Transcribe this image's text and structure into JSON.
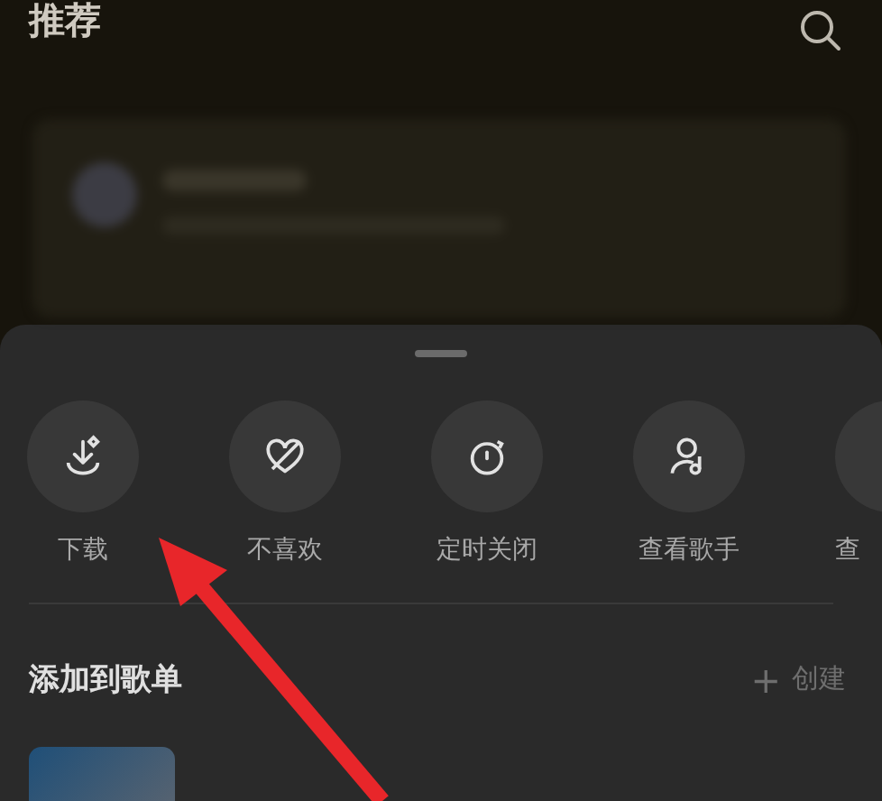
{
  "header": {
    "title": "推荐"
  },
  "sheet": {
    "actions": [
      {
        "kind": "download",
        "label": "下载"
      },
      {
        "kind": "dislike",
        "label": "不喜欢"
      },
      {
        "kind": "timer",
        "label": "定时关闭"
      },
      {
        "kind": "artist",
        "label": "查看歌手"
      },
      {
        "kind": "other",
        "label": "查"
      }
    ],
    "playlist_section": {
      "title": "添加到歌单",
      "create_icon": "+",
      "create_label": "创建"
    }
  }
}
